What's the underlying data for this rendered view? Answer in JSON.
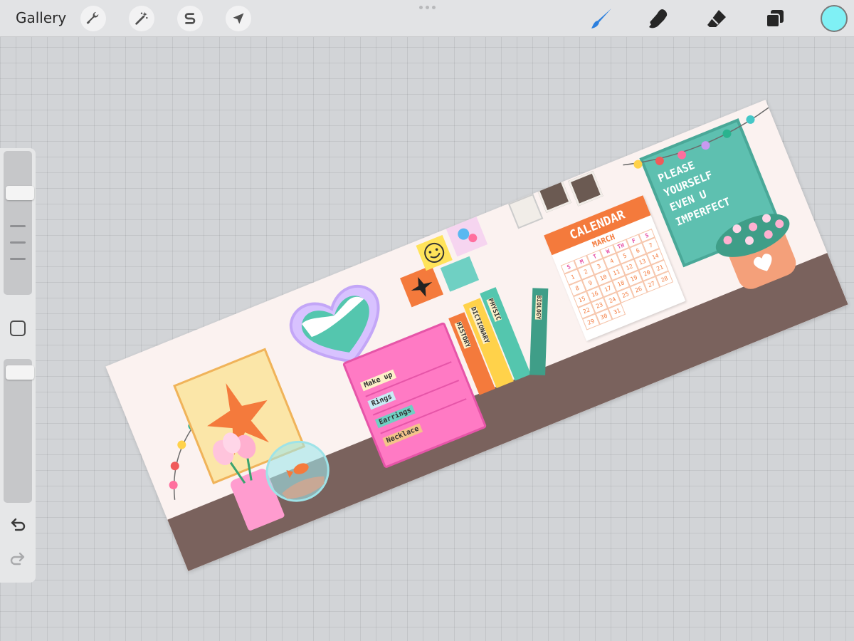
{
  "topbar": {
    "gallery_label": "Gallery",
    "left_tools": [
      {
        "name": "actions",
        "icon": "wrench-icon"
      },
      {
        "name": "adjustments",
        "icon": "magic-wand-icon"
      },
      {
        "name": "selection",
        "icon": "selection-s-icon"
      },
      {
        "name": "transform",
        "icon": "arrow-cursor-icon"
      }
    ],
    "right_tools": [
      {
        "name": "brush",
        "icon": "brush-icon",
        "active": true
      },
      {
        "name": "smudge",
        "icon": "smudge-finger-icon"
      },
      {
        "name": "eraser",
        "icon": "eraser-icon"
      },
      {
        "name": "layers",
        "icon": "layers-icon"
      }
    ],
    "current_color": "#7ff0f5",
    "active_tool_color": "#2b7fde"
  },
  "sidebar": {
    "brush_size_level": 0.27,
    "opacity_level": 0.95,
    "undo_icon": "undo-icon",
    "redo_icon": "redo-icon"
  },
  "artwork": {
    "drawer_labels": [
      "Make up",
      "Rings",
      "Earrings",
      "Necklace"
    ],
    "books": [
      "HISTORY",
      "DICTIONARY",
      "PHYSIC",
      "BIOLOGY"
    ],
    "calendar_title": "CALENDAR",
    "calendar_month": "MARCH",
    "calendar_weekdays": [
      "S",
      "M",
      "T",
      "W",
      "TH",
      "F",
      "S"
    ],
    "calendar_days": [
      "1",
      "2",
      "3",
      "4",
      "5",
      "6",
      "7",
      "8",
      "9",
      "10",
      "11",
      "12",
      "13",
      "14",
      "15",
      "16",
      "17",
      "18",
      "19",
      "20",
      "21",
      "22",
      "23",
      "24",
      "25",
      "26",
      "27",
      "28",
      "29",
      "30",
      "31"
    ],
    "poster_lines": [
      "PLEASE",
      "YOURSELF",
      "EVEN U",
      "IMPERFECT"
    ]
  }
}
